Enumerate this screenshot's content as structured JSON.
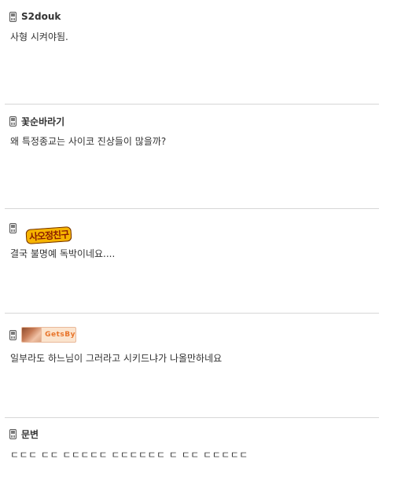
{
  "comments": [
    {
      "nickname": "S2douk",
      "nickname_type": "text",
      "text": "사형 시켜야됨."
    },
    {
      "nickname": "꽃순바라기",
      "nickname_type": "text",
      "text": "왜 특정종교는 사이코 진상들이 많을까?"
    },
    {
      "nickname": "사오정친구",
      "nickname_type": "image",
      "text": "결국 불명예 독박이네요...."
    },
    {
      "nickname": "GetsBy",
      "nickname_type": "image",
      "text": "일부라도 하느님이 그러라고 시키드냐가 나올만하네요"
    },
    {
      "nickname": "문변",
      "nickname_type": "text",
      "text": "ㄷㄷㄷ ㄷㄷ ㄷㄷㄷㄷㄷ ㄷㄷㄷㄷㄷㄷ ㄷ ㄷㄷ ㄷㄷㄷㄷㄷ"
    }
  ],
  "icons": {
    "device_icon": "mobile-phone-icon"
  },
  "colors": {
    "divider": "#d6d6d6",
    "text": "#333333",
    "banner_accent": "#e8742a"
  }
}
